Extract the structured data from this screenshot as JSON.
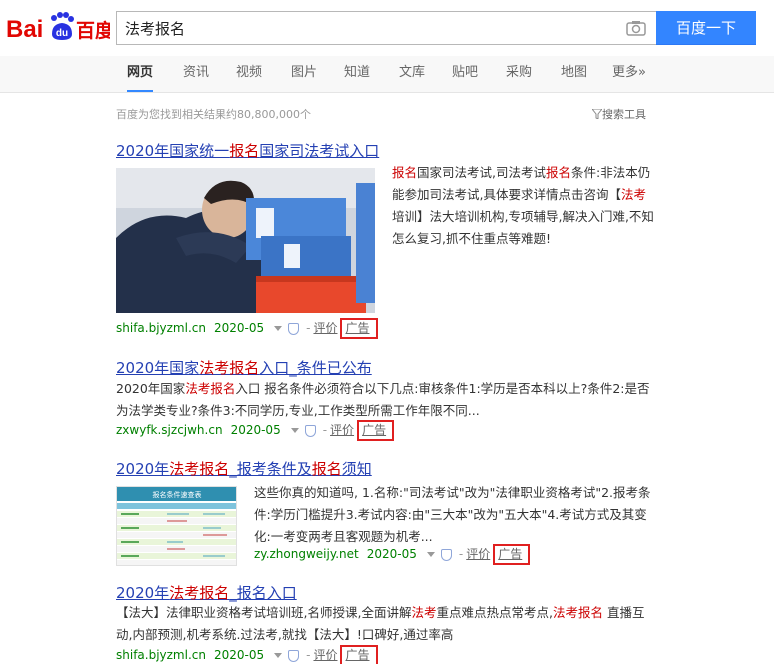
{
  "header": {
    "logo_text_left": "Bai",
    "logo_text_du": "du",
    "logo_text_right": "百度",
    "search_value": "法考报名",
    "search_button": "百度一下"
  },
  "tabs": [
    "网页",
    "资讯",
    "视频",
    "图片",
    "知道",
    "文库",
    "贴吧",
    "采购",
    "地图",
    "更多»"
  ],
  "meta": {
    "result_count": "百度为您找到相关结果约80,800,000个",
    "search_tools": "搜索工具"
  },
  "results": [
    {
      "title_parts": [
        "2020年国家统一",
        "报名",
        "国家司法考试入口"
      ],
      "abstract_parts": [
        "报名",
        "国家司法考试,司法考试",
        "报名",
        "条件:非法本仍能参加司法考试,具体要求详情点击咨询【",
        "法考",
        "培训】法大培训机构,专项辅导,解决入门难,不知怎么复习,抓不住重点等难题!"
      ],
      "url": "shifa.bjyzml.cn",
      "date": "2020-05",
      "eval": "评价",
      "ad": "广告"
    },
    {
      "title_parts": [
        "2020年国家",
        "法考报名",
        "入口_条件已公布"
      ],
      "abstract_parts": [
        "2020年国家",
        "法考报名",
        "入口 报名条件必须符合以下几点:审核条件1:学历是否本科以上?条件2:是否为法学类专业?条件3:不同学历,专业,工作类型所需工作年限不同..."
      ],
      "url": "zxwyfk.sjzcjwh.cn",
      "date": "2020-05",
      "eval": "评价",
      "ad": "广告"
    },
    {
      "title_parts": [
        "2020年",
        "法考报名",
        "_报考条件及",
        "报名",
        "须知"
      ],
      "abstract": "这些你真的知道吗, 1.名称:\"司法考试\"改为\"法律职业资格考试\"2.报考条件:学历门槛提升3.考试内容:由\"三大本\"改为\"五大本\"4.考试方式及其变化:一考变两考且客观题为机考...",
      "url": "zy.zhongweijy.net",
      "date": "2020-05",
      "eval": "评价",
      "ad": "广告",
      "thumb_title": "报名条件速查表"
    },
    {
      "title_parts": [
        "2020年",
        "法考报名",
        "_报名入口"
      ],
      "abstract_parts": [
        "【法大】法律职业资格考试培训班,名师授课,全面讲解",
        "法考",
        "重点难点热点常考点,",
        "法考报名",
        " 直播互动,内部预测,机考系统.过法考,就找【法大】!口碑好,通过率高"
      ],
      "url": "shifa.bjyzml.cn",
      "date": "2020-05",
      "eval": "评价",
      "ad": "广告"
    }
  ],
  "colors": {
    "accent": "#3385ff",
    "link": "#2440b3",
    "highlight": "#cc0000",
    "url_green": "#008000",
    "ad_box": "#e02020"
  }
}
